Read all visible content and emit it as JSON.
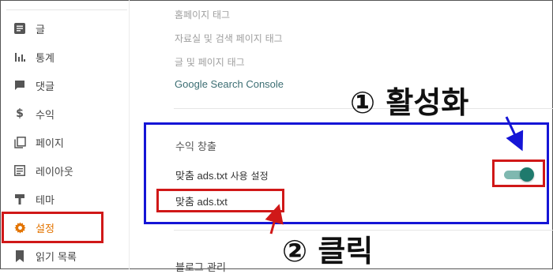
{
  "sidebar": {
    "items": [
      {
        "label": "글",
        "icon": "posts-icon",
        "active": false
      },
      {
        "label": "통계",
        "icon": "stats-icon",
        "active": false
      },
      {
        "label": "댓글",
        "icon": "comments-icon",
        "active": false
      },
      {
        "label": "수익",
        "icon": "earnings-icon",
        "active": false
      },
      {
        "label": "페이지",
        "icon": "pages-icon",
        "active": false
      },
      {
        "label": "레이아웃",
        "icon": "layout-icon",
        "active": false
      },
      {
        "label": "테마",
        "icon": "theme-icon",
        "active": false
      },
      {
        "label": "설정",
        "icon": "gear-icon",
        "active": true
      },
      {
        "label": "읽기 목록",
        "icon": "bookmark-icon",
        "active": false
      }
    ],
    "active_color": "#e37400"
  },
  "main": {
    "links": [
      {
        "label": "홈페이지 태그"
      },
      {
        "label": "자료실 및 검색 페이지 태그"
      },
      {
        "label": "글 및 페이지 태그"
      },
      {
        "label": "Google Search Console"
      }
    ],
    "monetization": {
      "title": "수익 창출",
      "custom_ads_txt_label_latin": "맞춤 ads.txt",
      "custom_ads_txt_label_rest": " 사용 설정",
      "custom_ads_txt_enabled": true,
      "ads_txt_link": "맞춤 ads.txt"
    },
    "next_section_title": "블로그 관리"
  },
  "annotations": {
    "step1": "① 활성화",
    "step2": "② 클릭",
    "box_blue": "#1515d6",
    "box_red": "#d01818"
  }
}
